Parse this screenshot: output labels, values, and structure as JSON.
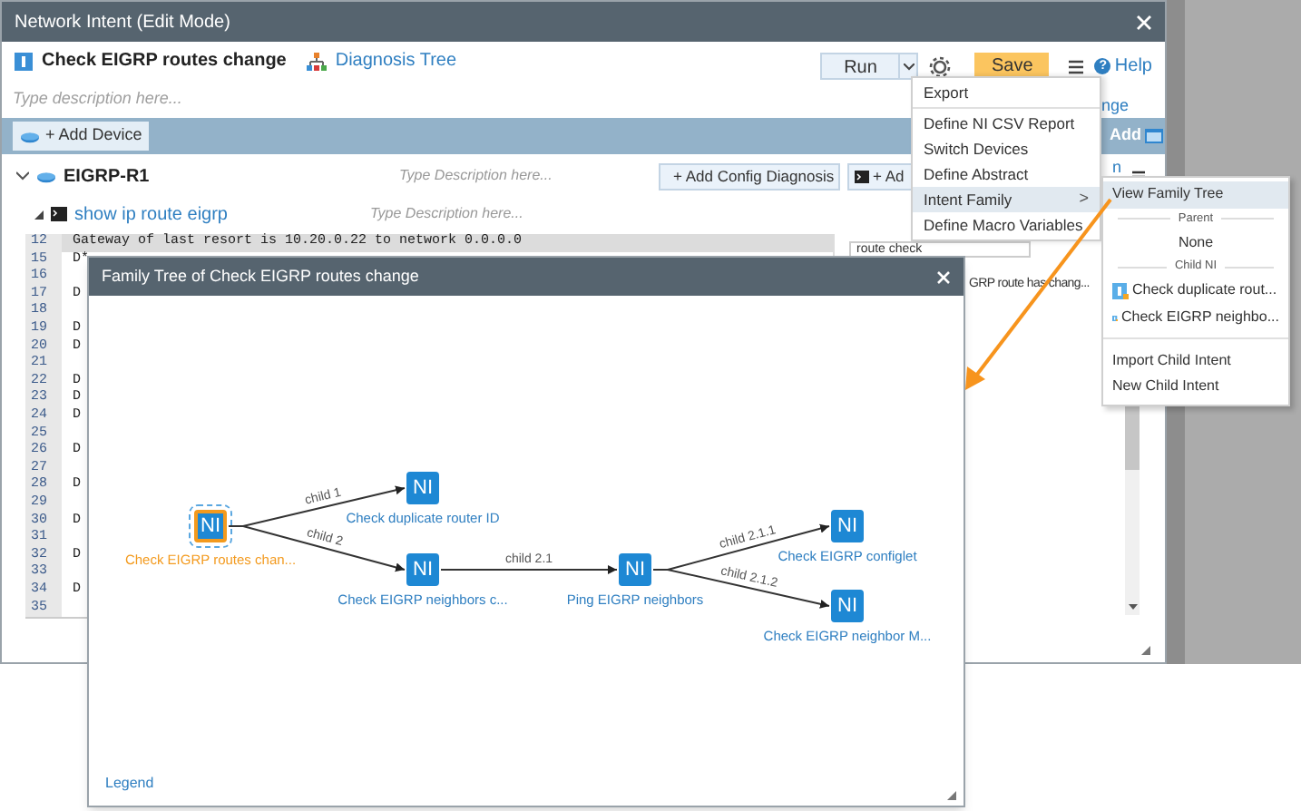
{
  "window": {
    "title": "Network Intent (Edit Mode)"
  },
  "header": {
    "intent_name": "Check EIGRP routes change",
    "diagnosis_tree_link": "Diagnosis Tree",
    "run_button": "Run",
    "save_button": "Save",
    "help_icon_glyph": "?",
    "help_link": "Help"
  },
  "description": {
    "placeholder": "Type description here...",
    "side_link_fragment": "nge"
  },
  "device_bar": {
    "add_device_button": "+ Add Device",
    "add_button": "Add"
  },
  "device": {
    "name": "EIGRP-R1",
    "expanded": true,
    "description_placeholder": "Type Description here...",
    "add_config_diagnosis_button": "+ Add Config Diagnosis",
    "add_button_fragment": "+ Ad",
    "button_fragment": "n"
  },
  "command": {
    "name": "show ip route eigrp",
    "expanded": true,
    "description_placeholder": "Type Description here...",
    "lines": [
      {
        "number": "12",
        "text": "Gateway of last resort is 10.20.0.22 to network 0.0.0.0",
        "highlighted": true
      },
      {
        "number": "15",
        "text": "D*",
        "highlighted": false
      },
      {
        "number": "16",
        "highlighted": false
      },
      {
        "number": "17",
        "text": "D",
        "highlighted": false
      },
      {
        "number": "18",
        "highlighted": false
      },
      {
        "number": "19",
        "text": "D",
        "highlighted": false
      },
      {
        "number": "20",
        "text": "D",
        "highlighted": false
      },
      {
        "number": "21",
        "highlighted": false
      },
      {
        "number": "22",
        "text": "D",
        "highlighted": false
      },
      {
        "number": "23",
        "text": "D",
        "highlighted": false
      },
      {
        "number": "24",
        "text": "D",
        "highlighted": false
      },
      {
        "number": "25",
        "highlighted": false
      },
      {
        "number": "26",
        "text": "D",
        "highlighted": false
      },
      {
        "number": "27",
        "highlighted": false
      },
      {
        "number": "28",
        "text": "D",
        "highlighted": false
      },
      {
        "number": "29",
        "highlighted": false
      },
      {
        "number": "30",
        "text": "D",
        "highlighted": false
      },
      {
        "number": "31",
        "highlighted": false
      },
      {
        "number": "32",
        "text": "D",
        "highlighted": false
      },
      {
        "number": "33",
        "highlighted": false
      },
      {
        "number": "34",
        "text": "D",
        "highlighted": false
      },
      {
        "number": "35",
        "highlighted": false
      }
    ]
  },
  "side_panel": {
    "field_value": "route check",
    "message": "GRP route has chang..."
  },
  "more_menu": {
    "items": [
      {
        "kind": "item",
        "label": "Export",
        "selected": false
      },
      {
        "kind": "separator"
      },
      {
        "kind": "item",
        "label": "Define NI CSV Report",
        "selected": false
      },
      {
        "kind": "item",
        "label": "Switch Devices",
        "selected": false
      },
      {
        "kind": "item",
        "label": "Define Abstract",
        "selected": false
      },
      {
        "kind": "item",
        "label": "Intent Family",
        "selected": true,
        "arrow": ">"
      },
      {
        "kind": "item",
        "label": "Define Macro Variables",
        "selected": false
      }
    ]
  },
  "intent_family_submenu": {
    "items": [
      {
        "kind": "item",
        "label": "View Family Tree",
        "selected": true
      },
      {
        "kind": "header",
        "label": "Parent"
      },
      {
        "kind": "item",
        "label": "None",
        "selected": false,
        "centered": true
      },
      {
        "kind": "header",
        "label": "Child NI"
      },
      {
        "kind": "intent",
        "label": "Check duplicate rout...",
        "selected": false
      },
      {
        "kind": "intent",
        "label": "Check EIGRP neighbo...",
        "selected": false
      },
      {
        "kind": "separator"
      },
      {
        "kind": "item",
        "label": "Import Child Intent",
        "selected": false
      },
      {
        "kind": "item",
        "label": "New Child Intent",
        "selected": false
      }
    ]
  },
  "family_tree_dialog": {
    "title": "Family Tree of Check EIGRP routes change",
    "nodes": [
      {
        "badge": "NI",
        "label": "Check EIGRP routes chan...",
        "selected": true
      },
      {
        "badge": "NI",
        "label": "Check duplicate router ID",
        "selected": false
      },
      {
        "badge": "NI",
        "label": "Check EIGRP neighbors c...",
        "selected": false
      },
      {
        "badge": "NI",
        "label": "Ping EIGRP neighbors",
        "selected": false
      },
      {
        "badge": "NI",
        "label": "Check EIGRP configlet",
        "selected": false
      },
      {
        "badge": "NI",
        "label": "Check EIGRP neighbor M...",
        "selected": false
      }
    ],
    "edges": [
      {
        "label": "child 1"
      },
      {
        "label": "child 2"
      },
      {
        "label": "child 2.1"
      },
      {
        "label": "child 2.1.1"
      },
      {
        "label": "child 2.1.2"
      }
    ],
    "legend_link": "Legend"
  }
}
